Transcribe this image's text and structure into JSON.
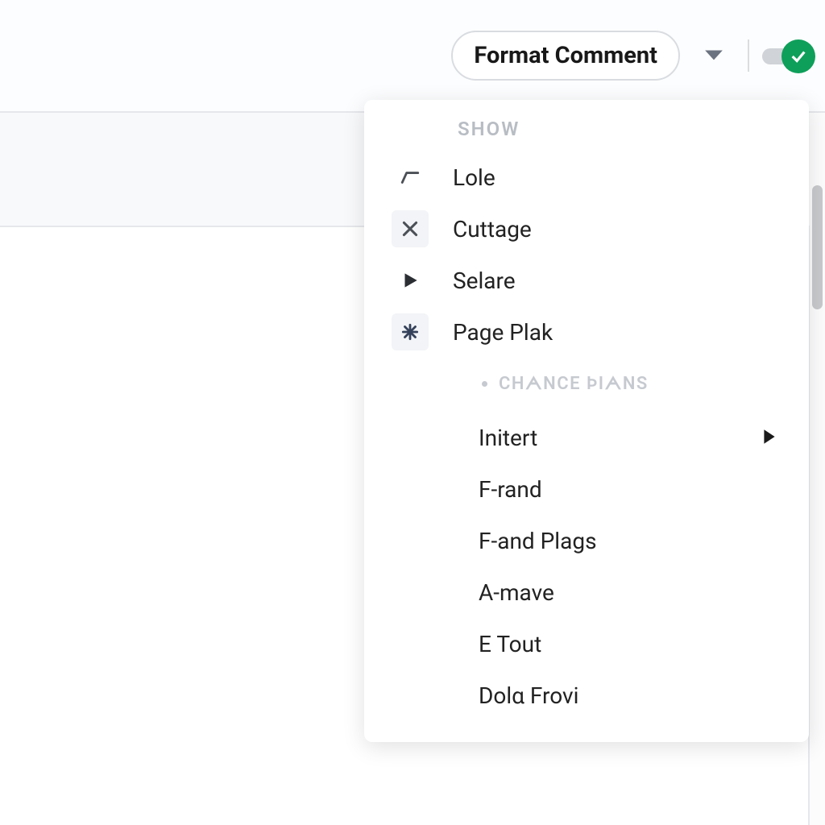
{
  "toolbar": {
    "format_label": "Format Comment"
  },
  "menu": {
    "section1_header": "SHOW",
    "items1": [
      {
        "label": "Lole"
      },
      {
        "label": "Cuttage"
      },
      {
        "label": "Selare"
      },
      {
        "label": "Page Plak"
      }
    ],
    "section2_header": "CHᗅNCE ÞIᗅNS",
    "items2": [
      {
        "label": "Initert",
        "has_submenu": true
      },
      {
        "label": "F-rand"
      },
      {
        "label": "F-and Plags"
      },
      {
        "label": "A-mave"
      },
      {
        "label": "E Tout"
      },
      {
        "label": "Dolα Frovi"
      }
    ]
  }
}
